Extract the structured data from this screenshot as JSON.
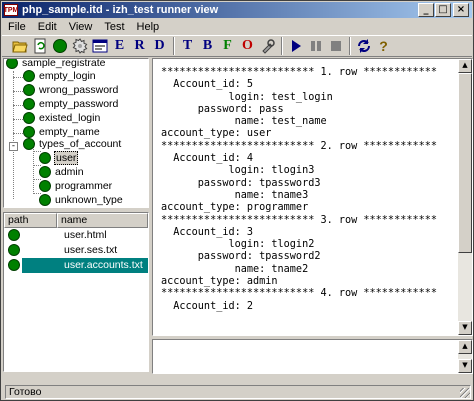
{
  "window": {
    "title": "php_sample.itd - izh_test runner view",
    "app_icon_text": "TPM"
  },
  "menu": [
    "File",
    "Edit",
    "View",
    "Test",
    "Help"
  ],
  "toolbar": {
    "letters": {
      "t": "T",
      "b": "B",
      "f": "F",
      "o": "O",
      "e": "E",
      "r": "R",
      "d": "D"
    },
    "help_glyph": "?"
  },
  "tree": {
    "root": "sample_registrate",
    "children": [
      "empty_login",
      "wrong_password",
      "empty_password",
      "existed_login",
      "empty_name",
      "types_of_account"
    ],
    "types_of_account_children": [
      "user",
      "admin",
      "programmer",
      "unknown_type"
    ],
    "selected": "user"
  },
  "files": {
    "headers": {
      "path": "path",
      "name": "name"
    },
    "rows": [
      "user.html",
      "user.ses.txt",
      "user.accounts.txt"
    ],
    "selected_index": 2
  },
  "log": {
    "lines": [
      "************************* 1. row ************",
      "  Account_id: 5",
      "           login: test_login",
      "      password: pass",
      "            name: test_name",
      "account_type: user",
      "************************* 2. row ************",
      "  Account_id: 4",
      "           login: tlogin3",
      "      password: tpassword3",
      "            name: tname3",
      "account_type: programmer",
      "************************* 3. row ************",
      "  Account_id: 3",
      "           login: tlogin2",
      "      password: tpassword2",
      "            name: tname2",
      "account_type: admin",
      "************************* 4. row ************",
      "  Account_id: 2"
    ]
  },
  "status": "Готово",
  "colors": {
    "tree_dot": "#008000",
    "selection": "#008080"
  }
}
